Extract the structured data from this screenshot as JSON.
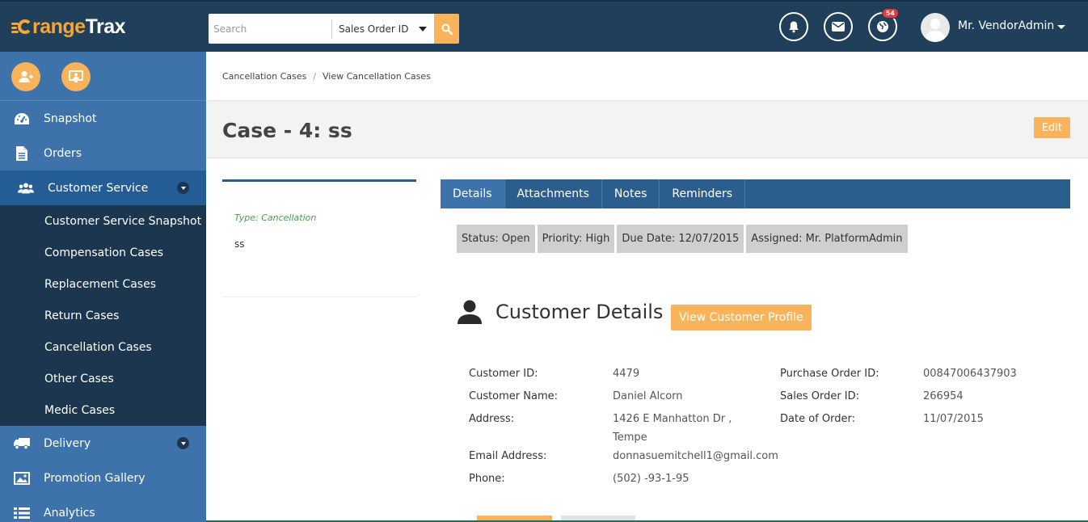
{
  "brand": {
    "logo_first": "range",
    "logo_second": "Trax"
  },
  "header": {
    "search_placeholder": "Search",
    "search_type": "Sales Order ID",
    "notifications_badge": "54",
    "user_name": "Mr. VendorAdmin"
  },
  "sidebar": {
    "items": [
      {
        "label": "Snapshot",
        "icon": "dashboard-icon"
      },
      {
        "label": "Orders",
        "icon": "document-icon"
      },
      {
        "label": "Customer Service",
        "icon": "users-icon"
      },
      {
        "label": "Delivery",
        "icon": "truck-icon"
      },
      {
        "label": "Promotion Gallery",
        "icon": "image-icon"
      },
      {
        "label": "Analytics",
        "icon": "list-icon"
      }
    ],
    "submenu": [
      "Customer Service Snapshot",
      "Compensation Cases",
      "Replacement Cases",
      "Return Cases",
      "Cancellation Cases",
      "Other Cases",
      "Medic Cases"
    ]
  },
  "breadcrumb": {
    "parent": "Cancellation Cases",
    "separator": "/",
    "current": "View Cancellation Cases"
  },
  "page": {
    "title": "Case - 4: ss",
    "edit_label": "Edit"
  },
  "case_card": {
    "type": "Type: Cancellation",
    "text": "ss"
  },
  "tabs": [
    "Details",
    "Attachments",
    "Notes",
    "Reminders"
  ],
  "status": {
    "status": "Status: Open",
    "priority": "Priority: High",
    "due": "Due Date: 12/07/2015",
    "assigned": "Assigned: Mr. PlatformAdmin"
  },
  "customer": {
    "heading": "Customer Details",
    "view_profile": "View Customer Profile",
    "labels": {
      "id": "Customer ID:",
      "name": "Customer Name:",
      "address": "Address:",
      "email": "Email Address:",
      "phone": "Phone:",
      "po": "Purchase Order ID:",
      "so": "Sales Order ID:",
      "date": "Date of Order:"
    },
    "values": {
      "id": "4479",
      "name": "Daniel Alcorn",
      "address1": "1426 E Manhatton Dr ,",
      "address2": "Tempe",
      "email": "donnasuemitchell1@gmail.com",
      "phone": "(502) -93-1-95",
      "po": "00847006437903",
      "so": "266954",
      "date": "11/07/2015"
    }
  },
  "colors": {
    "topbar": "#1f3f5b",
    "sidebar": "#3d73aa",
    "submenu": "#1d3650",
    "accent": "#f9b35b",
    "tabs": "#2b5e8c"
  }
}
